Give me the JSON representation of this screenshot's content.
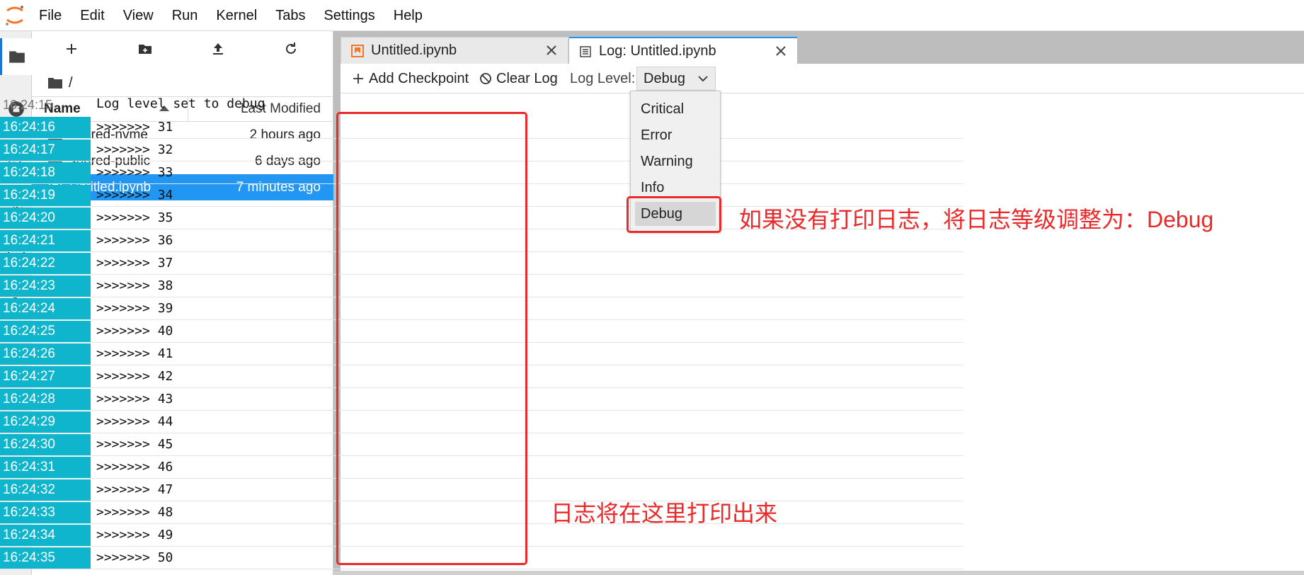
{
  "menubar": {
    "items": [
      "File",
      "Edit",
      "View",
      "Run",
      "Kernel",
      "Tabs",
      "Settings",
      "Help"
    ]
  },
  "activity_bar": {
    "icons": [
      "folder-icon",
      "running-icon",
      "commands-icon",
      "property-inspector-icon",
      "tabs-icon",
      "extension-icon"
    ]
  },
  "file_browser": {
    "breadcrumb": "/",
    "columns": {
      "name": "Name",
      "modified": "Last Modified"
    },
    "files": [
      {
        "name": "shared-nvme",
        "modified": "2 hours ago",
        "type": "folder"
      },
      {
        "name": "shared-public",
        "modified": "6 days ago",
        "type": "folder"
      },
      {
        "name": "Untitled.ipynb",
        "modified": "7 minutes ago",
        "type": "notebook",
        "selected": true
      }
    ]
  },
  "tabs": [
    {
      "label": "Untitled.ipynb",
      "active": false
    },
    {
      "label": "Log: Untitled.ipynb",
      "active": true
    }
  ],
  "toolbar": {
    "add_checkpoint": "Add Checkpoint",
    "clear_log": "Clear Log",
    "log_level_label": "Log Level:",
    "log_level_value": "Debug"
  },
  "log_level_options": [
    "Critical",
    "Error",
    "Warning",
    "Info",
    "Debug"
  ],
  "log": {
    "first": {
      "time": "16:24:15",
      "message": "Log level set to debug"
    },
    "entries": [
      {
        "time": "16:24:16",
        "message": ">>>>>>> 31"
      },
      {
        "time": "16:24:17",
        "message": ">>>>>>> 32"
      },
      {
        "time": "16:24:18",
        "message": ">>>>>>> 33"
      },
      {
        "time": "16:24:19",
        "message": ">>>>>>> 34"
      },
      {
        "time": "16:24:20",
        "message": ">>>>>>> 35"
      },
      {
        "time": "16:24:21",
        "message": ">>>>>>> 36"
      },
      {
        "time": "16:24:22",
        "message": ">>>>>>> 37"
      },
      {
        "time": "16:24:23",
        "message": ">>>>>>> 38"
      },
      {
        "time": "16:24:24",
        "message": ">>>>>>> 39"
      },
      {
        "time": "16:24:25",
        "message": ">>>>>>> 40"
      },
      {
        "time": "16:24:26",
        "message": ">>>>>>> 41"
      },
      {
        "time": "16:24:27",
        "message": ">>>>>>> 42"
      },
      {
        "time": "16:24:28",
        "message": ">>>>>>> 43"
      },
      {
        "time": "16:24:29",
        "message": ">>>>>>> 44"
      },
      {
        "time": "16:24:30",
        "message": ">>>>>>> 45"
      },
      {
        "time": "16:24:31",
        "message": ">>>>>>> 46"
      },
      {
        "time": "16:24:32",
        "message": ">>>>>>> 47"
      },
      {
        "time": "16:24:33",
        "message": ">>>>>>> 48"
      },
      {
        "time": "16:24:34",
        "message": ">>>>>>> 49"
      },
      {
        "time": "16:24:35",
        "message": ">>>>>>> 50"
      }
    ]
  },
  "annotations": {
    "debug_hint": "如果没有打印日志，将日志等级调整为：Debug",
    "log_hint": "日志将在这里打印出来",
    "color": "#ea2a2a"
  },
  "colors": {
    "accent": "#2196f3",
    "timestamp_bg": "#0fb5cc",
    "jupyter_orange": "#f37726"
  }
}
